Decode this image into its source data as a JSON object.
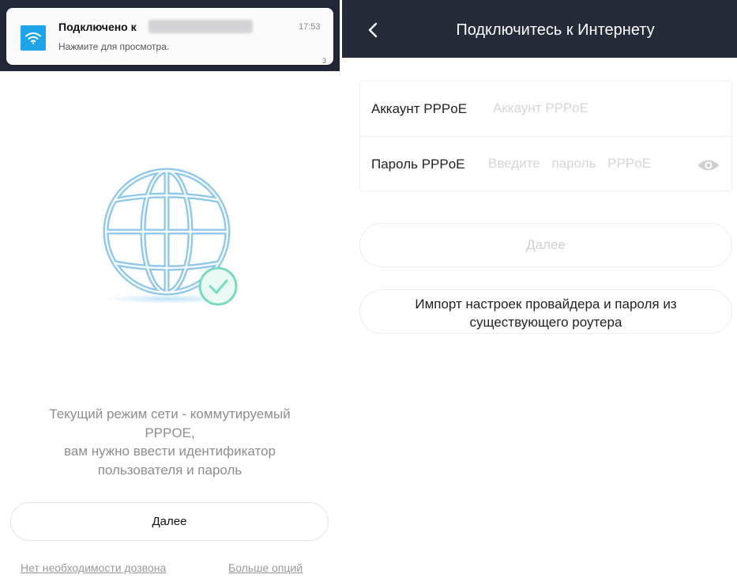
{
  "left_screen": {
    "notification": {
      "title": "Подключено к",
      "subtitle": "Нажмите для просмотра.",
      "time": "17:53",
      "count": "3",
      "icon": "wifi-icon"
    },
    "illustration": {
      "globe_icon": "globe-icon",
      "check_icon": "check-icon",
      "colors": {
        "globe": "#8cc6ec",
        "check": "#7ad9c0"
      }
    },
    "description": [
      "Текущий режим сети - коммутируемый",
      "PPPOE,",
      "вам нужно ввести идентификатор",
      "пользователя и пароль"
    ],
    "next_label": "Далее",
    "links": {
      "no_dial": "Нет необходимости дозвона",
      "more_options": "Больше опций"
    }
  },
  "right_screen": {
    "header": {
      "title": "Подключитесь к Интернету",
      "back_icon": "chevron-left-icon",
      "color": "#262b3a"
    },
    "form": {
      "account_label": "Аккаунт PPPoE",
      "account_placeholder": "Аккаунт PPPoE",
      "password_label": "Пароль PPPoE",
      "password_placeholder": "Введите пароль PPPoE",
      "eye_icon": "eye-icon"
    },
    "next_label": "Далее",
    "import_label_lines": [
      "Импорт настроек провайдера и пароля из",
      "существующего роутера"
    ]
  }
}
